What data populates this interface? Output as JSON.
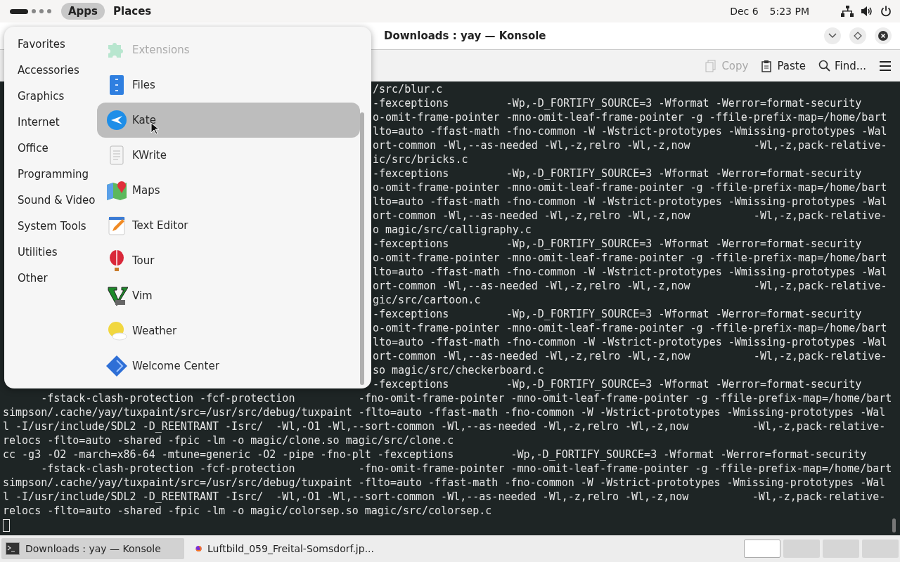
{
  "top_bar": {
    "menus": [
      {
        "label": "Apps",
        "selected": true
      },
      {
        "label": "Places",
        "selected": false
      }
    ],
    "date": "Dec 6",
    "time": "5:23 PM"
  },
  "window": {
    "title": "Downloads : yay — Konsole"
  },
  "toolbar": [
    {
      "label": "Copy",
      "kind": "copy",
      "disabled": true
    },
    {
      "label": "Paste",
      "kind": "paste",
      "disabled": false
    },
    {
      "label": "Find...",
      "kind": "find",
      "disabled": false
    }
  ],
  "terminal": {
    "lines_beside_menu": [
      "/src/blur.c",
      "-fexceptions         -Wp,-D_FORTIFY_SOURCE=3 -Wformat -Werror=format-security",
      "o-omit-frame-pointer -mno-omit-leaf-frame-pointer -g -ffile-prefix-map=/home/bart",
      "lto=auto -ffast-math -fno-common -W -Wstrict-prototypes -Wmissing-prototypes -Wal",
      "ort-common -Wl,--as-needed -Wl,-z,relro -Wl,-z,now          -Wl,-z,pack-relative-",
      "ic/src/bricks.c",
      "-fexceptions         -Wp,-D_FORTIFY_SOURCE=3 -Wformat -Werror=format-security",
      "o-omit-frame-pointer -mno-omit-leaf-frame-pointer -g -ffile-prefix-map=/home/bart",
      "lto=auto -ffast-math -fno-common -W -Wstrict-prototypes -Wmissing-prototypes -Wal",
      "ort-common -Wl,--as-needed -Wl,-z,relro -Wl,-z,now          -Wl,-z,pack-relative-",
      "o magic/src/calligraphy.c",
      "-fexceptions         -Wp,-D_FORTIFY_SOURCE=3 -Wformat -Werror=format-security",
      "o-omit-frame-pointer -mno-omit-leaf-frame-pointer -g -ffile-prefix-map=/home/bart",
      "lto=auto -ffast-math -fno-common -W -Wstrict-prototypes -Wmissing-prototypes -Wal",
      "ort-common -Wl,--as-needed -Wl,-z,relro -Wl,-z,now          -Wl,-z,pack-relative-",
      "gic/src/cartoon.c",
      "-fexceptions         -Wp,-D_FORTIFY_SOURCE=3 -Wformat -Werror=format-security",
      "o-omit-frame-pointer -mno-omit-leaf-frame-pointer -g -ffile-prefix-map=/home/bart",
      "lto=auto -ffast-math -fno-common -W -Wstrict-prototypes -Wmissing-prototypes -Wal",
      "ort-common -Wl,--as-needed -Wl,-z,relro -Wl,-z,now          -Wl,-z,pack-relative-",
      "so magic/src/checkerboard.c",
      "-fexceptions         -Wp,-D_FORTIFY_SOURCE=3 -Wformat -Werror=format-security"
    ],
    "lines": [
      "      -fstack-clash-protection -fcf-protection          -fno-omit-frame-pointer -mno-omit-leaf-frame-pointer -g -ffile-prefix-map=/home/bart",
      "simpson/.cache/yay/tuxpaint/src=/usr/src/debug/tuxpaint -flto=auto -ffast-math -fno-common -W -Wstrict-prototypes -Wmissing-prototypes -Wal",
      "l -I/usr/include/SDL2 -D_REENTRANT -Isrc/  -Wl,-O1 -Wl,--sort-common -Wl,--as-needed -Wl,-z,relro -Wl,-z,now          -Wl,-z,pack-relative-",
      "relocs -flto=auto -shared -fpic -lm -o magic/clone.so magic/src/clone.c",
      "cc -g3 -O2 -march=x86-64 -mtune=generic -O2 -pipe -fno-plt -fexceptions         -Wp,-D_FORTIFY_SOURCE=3 -Wformat -Werror=format-security",
      "      -fstack-clash-protection -fcf-protection          -fno-omit-frame-pointer -mno-omit-leaf-frame-pointer -g -ffile-prefix-map=/home/bart",
      "simpson/.cache/yay/tuxpaint/src=/usr/src/debug/tuxpaint -flto=auto -ffast-math -fno-common -W -Wstrict-prototypes -Wmissing-prototypes -Wal",
      "l -I/usr/include/SDL2 -D_REENTRANT -Isrc/  -Wl,-O1 -Wl,--sort-common -Wl,--as-needed -Wl,-z,relro -Wl,-z,now          -Wl,-z,pack-relative-",
      "relocs -flto=auto -shared -fpic -lm -o magic/colorsep.so magic/src/colorsep.c"
    ]
  },
  "apps_menu": {
    "categories": [
      {
        "label": "Favorites",
        "selected": false
      },
      {
        "label": "Accessories",
        "selected": false
      },
      {
        "label": "Graphics",
        "selected": false
      },
      {
        "label": "Internet",
        "selected": false
      },
      {
        "label": "Office",
        "selected": false
      },
      {
        "label": "Programming",
        "selected": false
      },
      {
        "label": "Sound & Video",
        "selected": false
      },
      {
        "label": "System Tools",
        "selected": false
      },
      {
        "label": "Utilities",
        "selected": false
      },
      {
        "label": "Other",
        "selected": false
      }
    ],
    "apps": [
      {
        "label": "Extensions",
        "kind": "puzzle",
        "selected": false,
        "dimmed": true
      },
      {
        "label": "Files",
        "kind": "files",
        "selected": false,
        "dimmed": false
      },
      {
        "label": "Kate",
        "kind": "kate",
        "selected": true,
        "dimmed": false
      },
      {
        "label": "KWrite",
        "kind": "page",
        "selected": false,
        "dimmed": false
      },
      {
        "label": "Maps",
        "kind": "map",
        "selected": false,
        "dimmed": false
      },
      {
        "label": "Text Editor",
        "kind": "pencil",
        "selected": false,
        "dimmed": false
      },
      {
        "label": "Tour",
        "kind": "balloon",
        "selected": false,
        "dimmed": false
      },
      {
        "label": "Vim",
        "kind": "vim",
        "selected": false,
        "dimmed": false
      },
      {
        "label": "Weather",
        "kind": "weather",
        "selected": false,
        "dimmed": false
      },
      {
        "label": "Welcome Center",
        "kind": "diamond",
        "selected": false,
        "dimmed": false
      }
    ]
  },
  "taskbar": {
    "tasks": [
      {
        "label": "Downloads : yay — Konsole",
        "kind": "terminal",
        "selected": true
      },
      {
        "label": "Luftbild_059_Freital-Somsdorf.jp...",
        "kind": "browser",
        "selected": false
      }
    ],
    "workspaces": [
      {
        "selected": true
      },
      {
        "selected": false
      },
      {
        "selected": false
      },
      {
        "selected": false
      }
    ]
  }
}
